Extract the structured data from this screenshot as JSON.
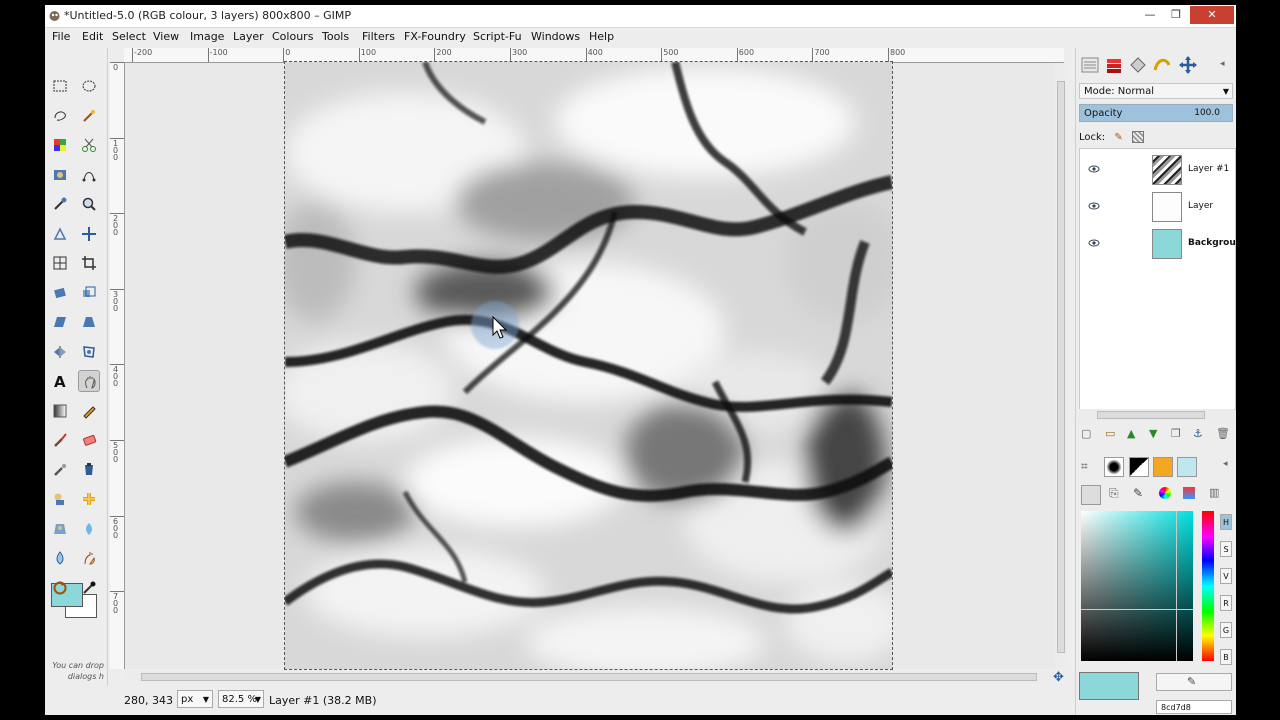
{
  "window": {
    "title": "*Untitled-5.0 (RGB colour, 3 layers) 800x800 – GIMP",
    "minimize": "—",
    "maximize": "❐",
    "close": "✕"
  },
  "menu": [
    "File",
    "Edit",
    "Select",
    "View",
    "Image",
    "Layer",
    "Colours",
    "Tools",
    "Filters",
    "FX-Foundry",
    "Script-Fu",
    "Windows",
    "Help"
  ],
  "toolbox": {
    "tools": [
      "rect-select",
      "ellipse-select",
      "free-select",
      "fuzzy-select",
      "select-by-color",
      "scissors-select",
      "foreground-select",
      "paths",
      "color-picker",
      "zoom",
      "measure",
      "move",
      "align",
      "crop",
      "rotate",
      "scale",
      "shear",
      "perspective",
      "flip",
      "cage-transform",
      "text",
      "smudge-hand",
      "blend",
      "pencil",
      "paintbrush",
      "eraser",
      "airbrush",
      "ink",
      "clone",
      "heal",
      "perspective-clone",
      "dodge-burn",
      "blur-sharpen",
      "smudge",
      "rotate-view",
      "ink-blot"
    ],
    "active_tool": "smudge-hand",
    "fg_color": "#8cd7d8",
    "bg_color": "#ffffff",
    "drop_hint": "You can drop dialogs h"
  },
  "ruler": {
    "h": [
      "-200",
      "-100",
      "0",
      "100",
      "200",
      "300",
      "400",
      "500",
      "600",
      "700",
      "800"
    ],
    "v": [
      "0",
      "100",
      "200",
      "300",
      "400",
      "500",
      "600",
      "700"
    ]
  },
  "status": {
    "coords": "280, 343",
    "unit": "px",
    "zoom": "82.5 %",
    "text": "Layer #1 (38.2 MB)"
  },
  "dock": {
    "mode_label": "Mode: Normal",
    "opacity_label": "Opacity",
    "opacity_value": "100.0",
    "lock_label": "Lock:",
    "layers": [
      {
        "name": "Layer #1",
        "thumb": "marble"
      },
      {
        "name": "Layer",
        "thumb": "white"
      },
      {
        "name": "Backgroun",
        "thumb": "#8cd7d8"
      }
    ],
    "color_hex": "8cd7d8",
    "channels": [
      "H",
      "S",
      "V",
      "R",
      "G",
      "B"
    ]
  },
  "colors": {
    "accent": "#8cd7d8",
    "selection_blue": "#9fc2dc"
  }
}
